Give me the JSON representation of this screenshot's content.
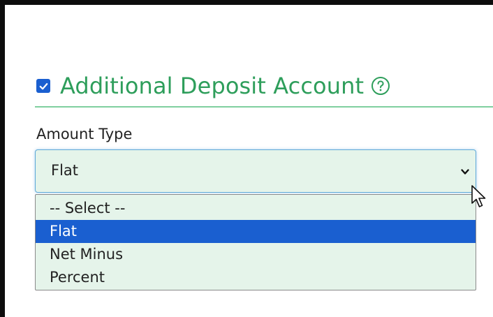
{
  "section": {
    "checked": true,
    "title": "Additional Deposit Account",
    "help_icon": "question-circle-icon",
    "accent_color": "#2e9e5b"
  },
  "amount_type": {
    "label": "Amount Type",
    "selected_value": "Flat",
    "options": [
      {
        "label": "-- Select --",
        "selected": false
      },
      {
        "label": "Flat",
        "selected": true
      },
      {
        "label": "Net Minus",
        "selected": false
      },
      {
        "label": "Percent",
        "selected": false
      }
    ],
    "highlight_color": "#1a5fd0",
    "field_background": "#e5f4ea"
  }
}
